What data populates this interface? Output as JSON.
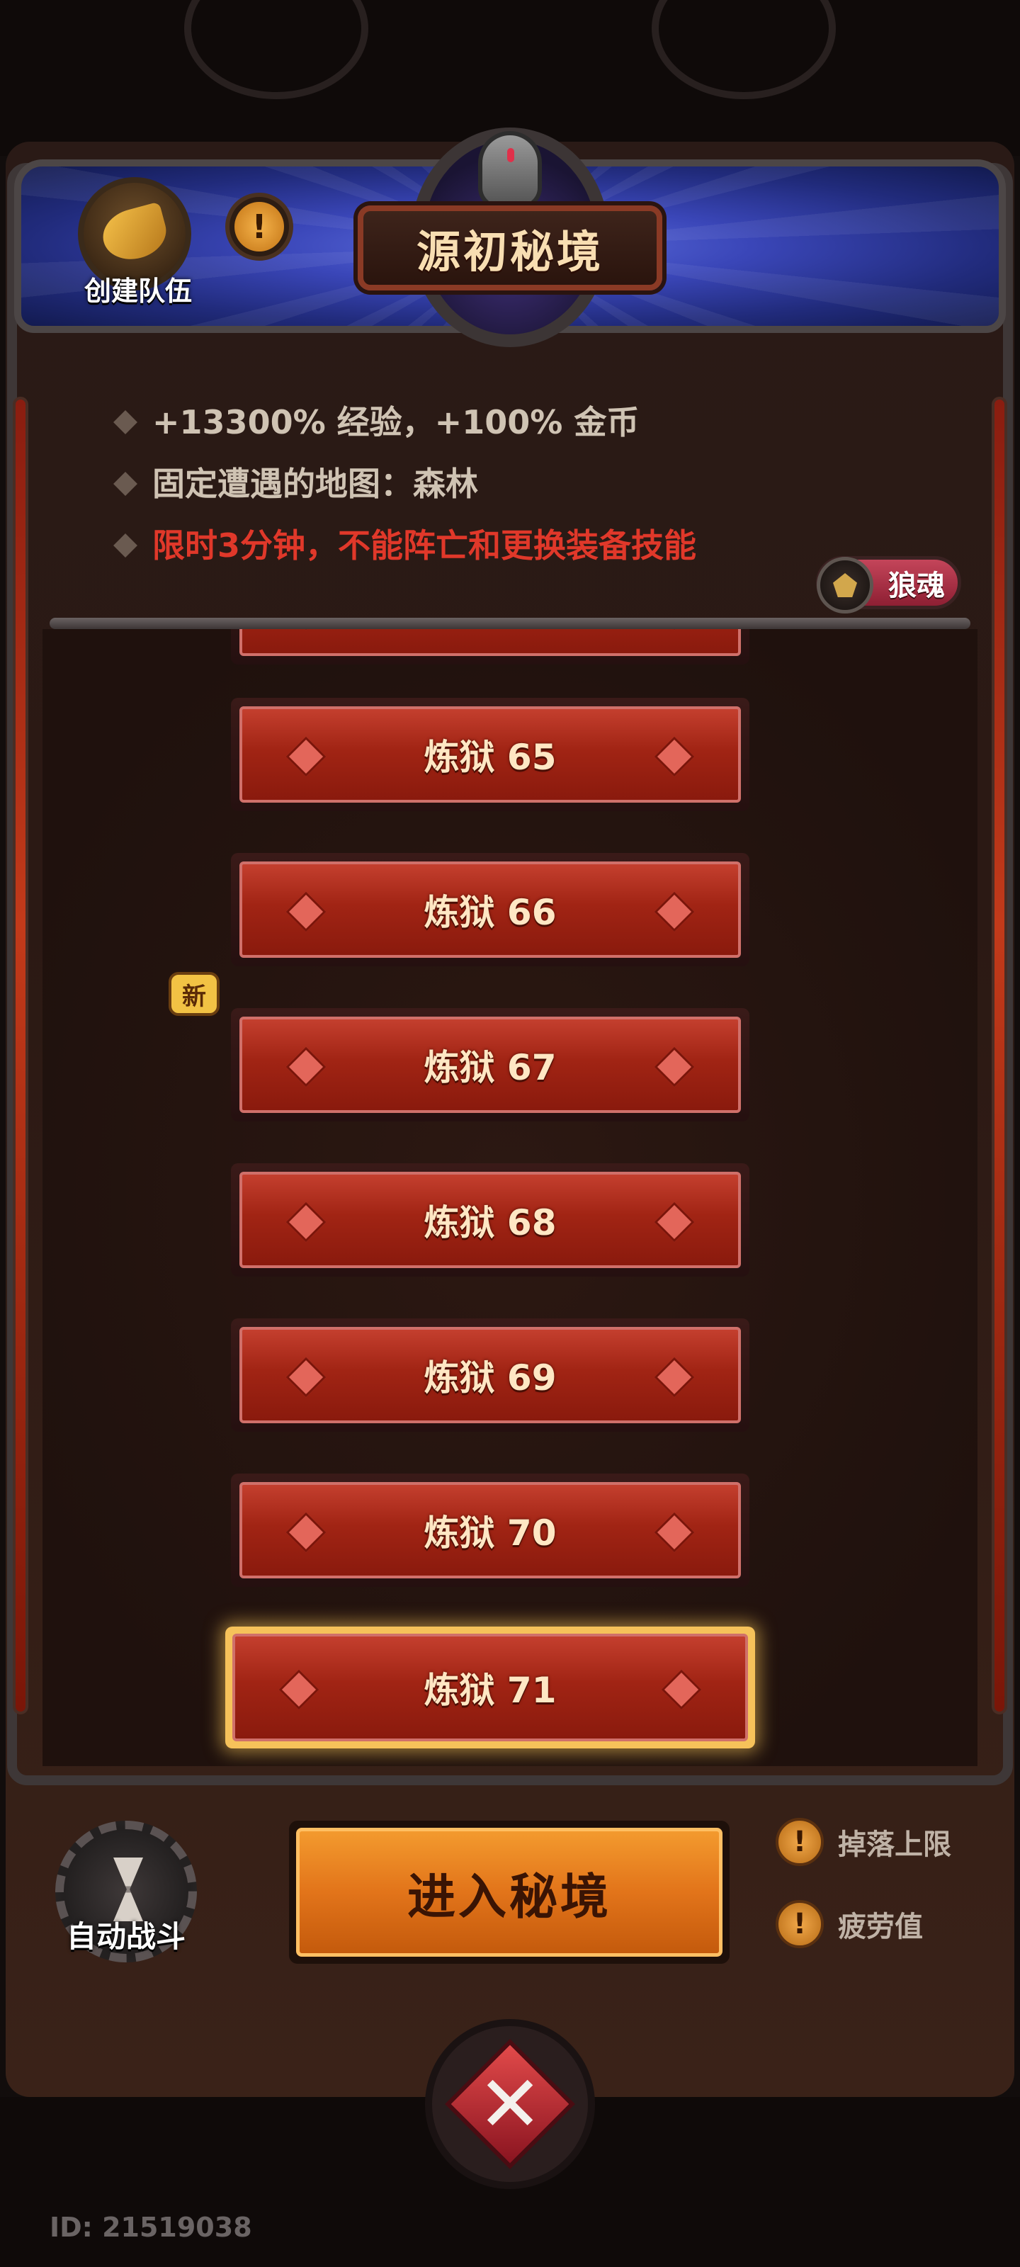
{
  "header": {
    "title": "源初秘境",
    "create_team_label": "创建队伍",
    "info_icon": "exclamation-icon"
  },
  "info_lines": [
    {
      "text": "+13300% 经验，+100% 金币",
      "color": "#cfc3b3"
    },
    {
      "text": "固定遭遇的地图：森林",
      "color": "#cfc3b3"
    },
    {
      "text": "限时3分钟，不能阵亡和更换装备技能",
      "color": "#e0382a"
    }
  ],
  "soul_badge": {
    "label": "狼魂",
    "icon": "wolf-head-icon"
  },
  "levels": [
    {
      "label": "炼狱 65"
    },
    {
      "label": "炼狱 66"
    },
    {
      "label": "炼狱 67"
    },
    {
      "label": "炼狱 68"
    },
    {
      "label": "炼狱 69"
    },
    {
      "label": "炼狱 70"
    },
    {
      "label": "炼狱 71",
      "selected": true,
      "new_tag": "新"
    }
  ],
  "bottom": {
    "auto_battle_label": "自动战斗",
    "enter_label": "进入秘境",
    "drop_limit_label": "掉落上限",
    "fatigue_label": "疲劳值",
    "close_icon": "close-x-icon"
  },
  "footer": {
    "id_text": "ID: 21519038"
  },
  "colors": {
    "accent_orange": "#e2741a",
    "level_red": "#a12414",
    "warning_red": "#e0382a",
    "header_blue": "#3a46b8"
  }
}
